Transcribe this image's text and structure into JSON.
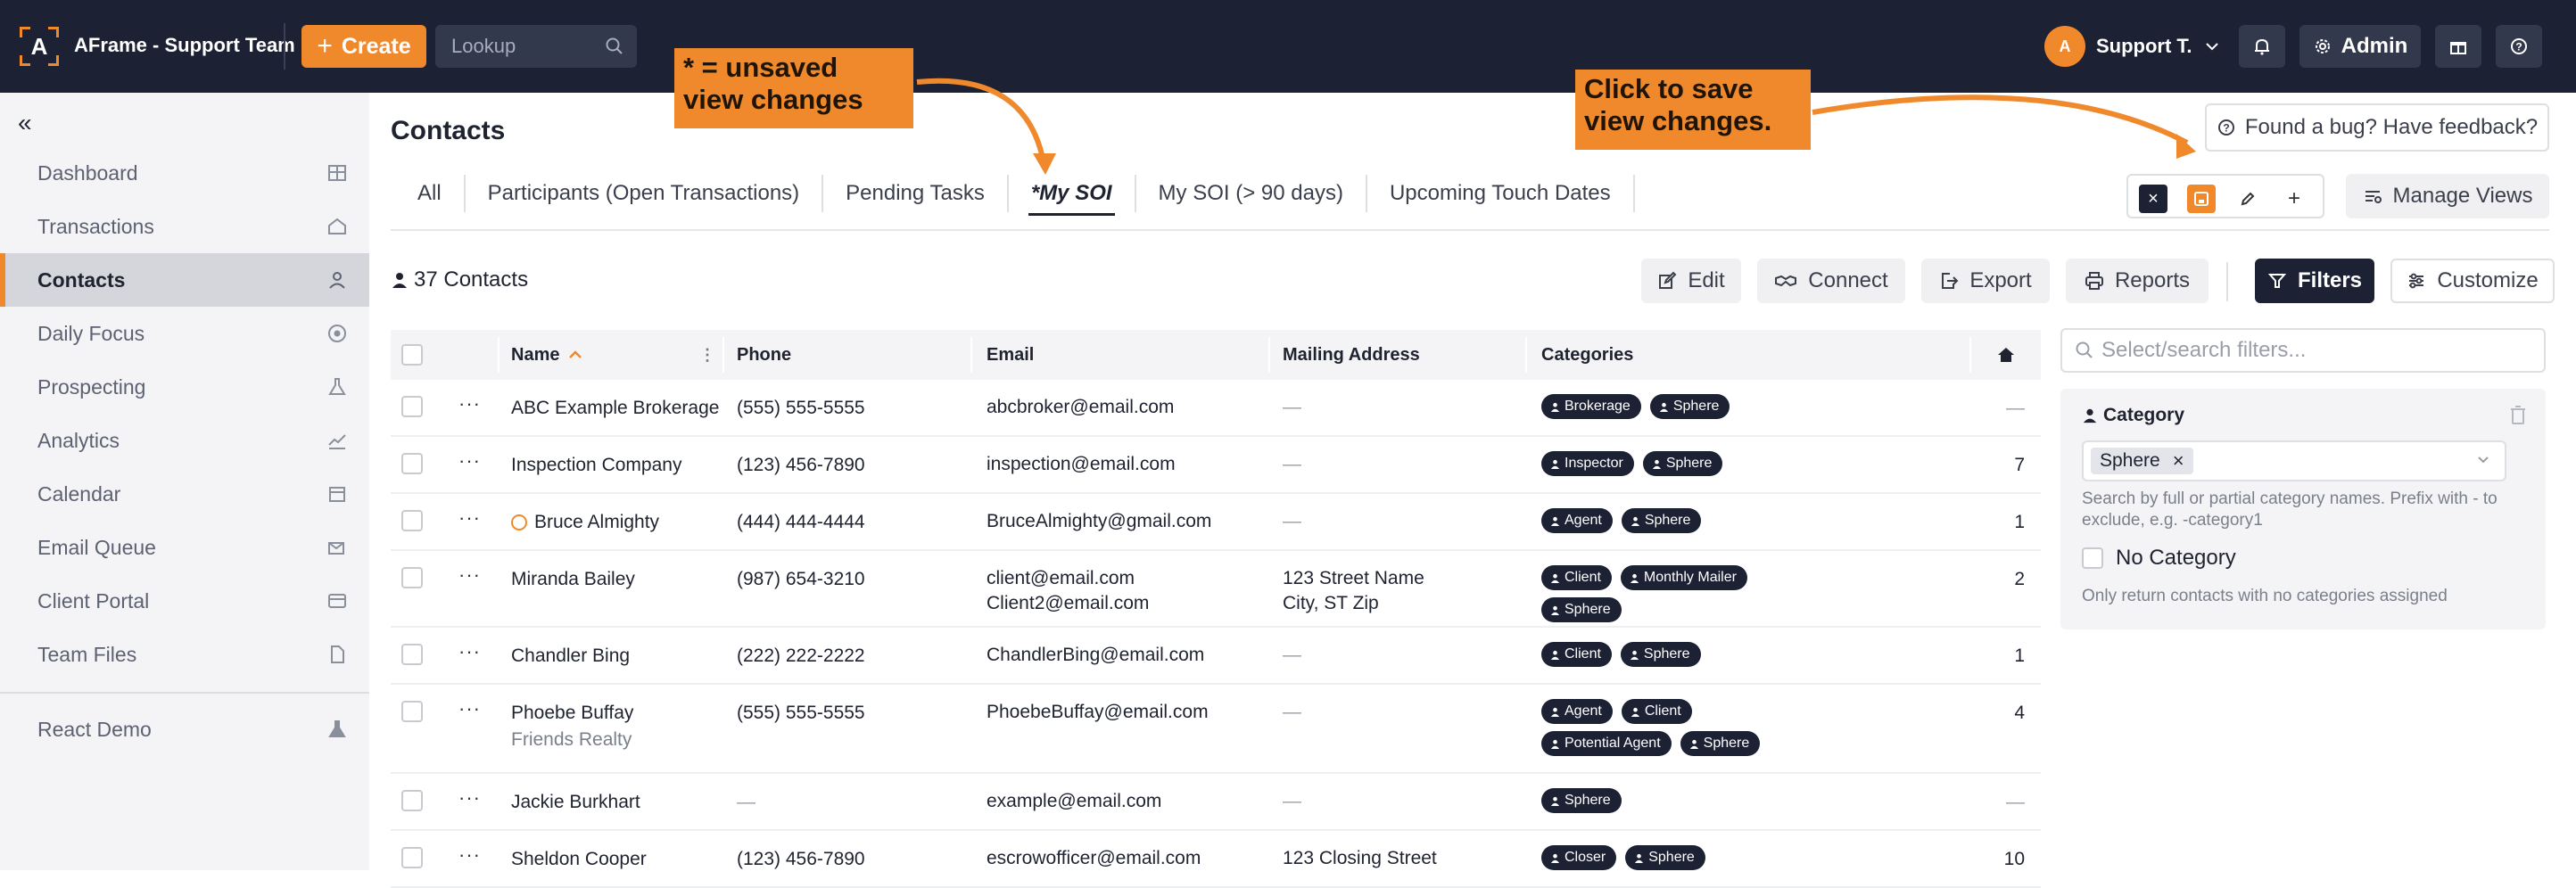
{
  "topbar": {
    "app_title": "AFrame - Support Team",
    "create_label": "Create",
    "lookup_placeholder": "Lookup",
    "user_initials": "A",
    "user_name": "Support T.",
    "admin_label": "Admin"
  },
  "sidebar": {
    "items": [
      {
        "label": "Dashboard",
        "icon": "dashboard-icon"
      },
      {
        "label": "Transactions",
        "icon": "home-icon"
      },
      {
        "label": "Contacts",
        "icon": "person-icon"
      },
      {
        "label": "Daily Focus",
        "icon": "target-icon"
      },
      {
        "label": "Prospecting",
        "icon": "lab-flask-icon"
      },
      {
        "label": "Analytics",
        "icon": "chart-icon"
      },
      {
        "label": "Calendar",
        "icon": "calendar-icon"
      },
      {
        "label": "Email Queue",
        "icon": "email-queue-icon"
      },
      {
        "label": "Client Portal",
        "icon": "portal-icon"
      },
      {
        "label": "Team Files",
        "icon": "file-icon"
      }
    ],
    "extra": {
      "label": "React Demo",
      "icon": "flask-icon"
    }
  },
  "main": {
    "title": "Contacts",
    "tabs": [
      {
        "label": "All"
      },
      {
        "label": "Participants (Open Transactions)"
      },
      {
        "label": "Pending Tasks"
      },
      {
        "label": "*My SOI"
      },
      {
        "label": "My SOI (> 90 days)"
      },
      {
        "label": "Upcoming Touch Dates"
      }
    ],
    "feedback_label": "Found a bug? Have feedback?",
    "manage_views_label": "Manage Views",
    "count_label": "37 Contacts",
    "actions": {
      "edit": "Edit",
      "connect": "Connect",
      "export": "Export",
      "reports": "Reports",
      "filters": "Filters",
      "customize": "Customize"
    }
  },
  "table": {
    "columns": [
      "Name",
      "Phone",
      "Email",
      "Mailing Address",
      "Categories"
    ],
    "rows": [
      {
        "name": "ABC Example Brokerage",
        "sub": "",
        "phone": "(555) 555-5555",
        "email": [
          "abcbroker@email.com"
        ],
        "address": [],
        "categories": [
          "Brokerage",
          "Sphere"
        ],
        "count": "—"
      },
      {
        "name": "Inspection Company",
        "sub": "",
        "phone": "(123) 456-7890",
        "email": [
          "inspection@email.com"
        ],
        "address": [],
        "categories": [
          "Inspector",
          "Sphere"
        ],
        "count": "7"
      },
      {
        "name": "Bruce Almighty",
        "sub": "",
        "phone": "(444) 444-4444",
        "email": [
          "BruceAlmighty@gmail.com"
        ],
        "address": [],
        "categories": [
          "Agent",
          "Sphere"
        ],
        "count": "1"
      },
      {
        "name": "Miranda Bailey",
        "sub": "",
        "phone": "(987) 654-3210",
        "email": [
          "client@email.com",
          "Client2@email.com"
        ],
        "address": [
          "123 Street Name",
          "City, ST Zip"
        ],
        "categories": [
          "Client",
          "Monthly Mailer",
          "Sphere"
        ],
        "count": "2"
      },
      {
        "name": "Chandler Bing",
        "sub": "",
        "phone": "(222) 222-2222",
        "email": [
          "ChandlerBing@email.com"
        ],
        "address": [],
        "categories": [
          "Client",
          "Sphere"
        ],
        "count": "1"
      },
      {
        "name": "Phoebe Buffay",
        "sub": "Friends Realty",
        "phone": "(555) 555-5555",
        "email": [
          "PhoebeBuffay@email.com"
        ],
        "address": [],
        "categories": [
          "Agent",
          "Client",
          "Potential Agent",
          "Sphere"
        ],
        "count": "4"
      },
      {
        "name": "Jackie Burkhart",
        "sub": "",
        "phone": "—",
        "email": [
          "example@email.com"
        ],
        "address": [],
        "categories": [
          "Sphere"
        ],
        "count": "—"
      },
      {
        "name": "Sheldon Cooper",
        "sub": "",
        "phone": "(123) 456-7890",
        "email": [
          "escrowofficer@email.com"
        ],
        "address": [
          "123 Closing Street"
        ],
        "categories": [
          "Closer",
          "Sphere"
        ],
        "count": "10"
      }
    ],
    "empty_value": "—"
  },
  "filter_panel": {
    "search_placeholder": "Select/search filters...",
    "category_title": "Category",
    "selected_value": "Sphere",
    "help_text": "Search by full or partial category names. Prefix with - to exclude, e.g. -category1",
    "no_category_label": "No Category",
    "no_category_help": "Only return contacts with no categories assigned"
  },
  "annotations": {
    "unsaved_note": "* = unsaved view changes",
    "save_note": "Click to save view changes."
  },
  "colors": {
    "accent": "#f0892b",
    "navy": "#1c2134"
  }
}
